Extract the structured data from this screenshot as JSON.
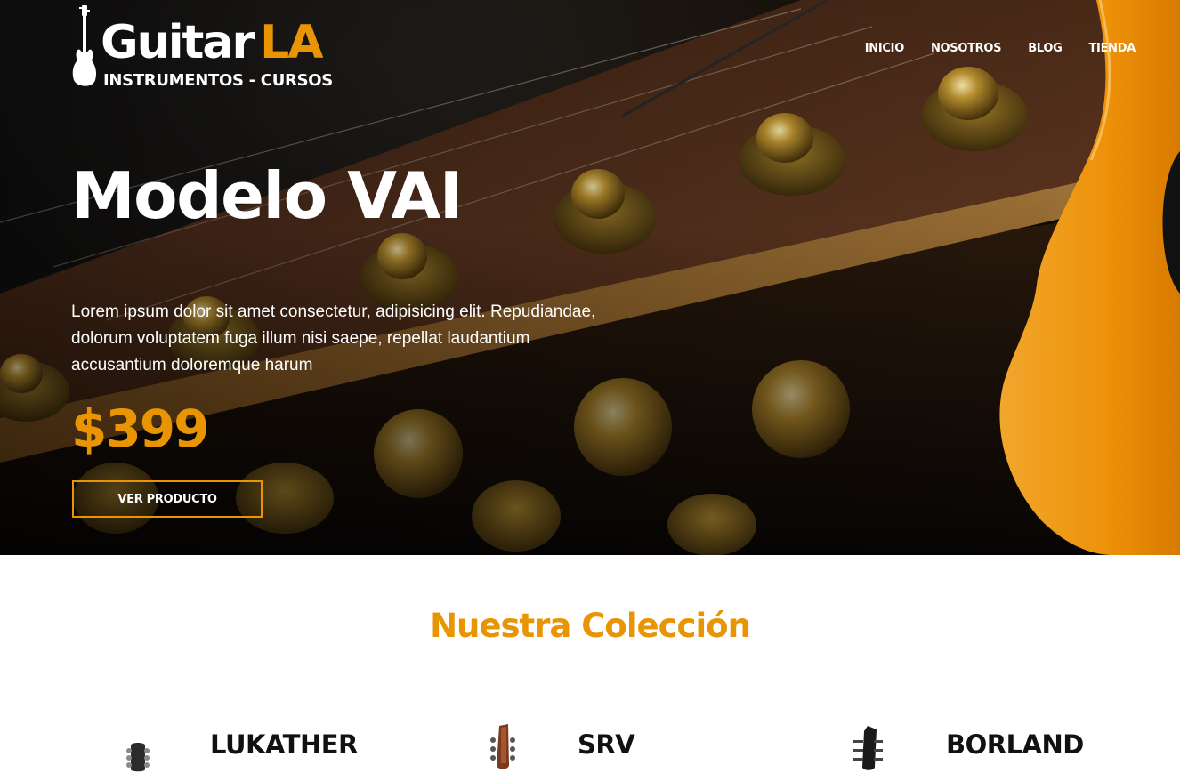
{
  "brand": {
    "name_primary": "Guitar",
    "name_accent": "LA",
    "tagline": "INSTRUMENTOS - CURSOS",
    "accent_color": "#e99402",
    "logo_icon": "electric-guitar-icon"
  },
  "nav": {
    "items": [
      {
        "label": "INICIO"
      },
      {
        "label": "NOSOTROS"
      },
      {
        "label": "BLOG"
      },
      {
        "label": "TIENDA"
      }
    ]
  },
  "hero": {
    "title": "Modelo VAI",
    "description": "Lorem ipsum dolor sit amet consectetur, adipisicing elit. Repudiandae, dolorum voluptatem fuga illum nisi saepe, repellat laudantium accusantium doloremque harum",
    "price": "$399",
    "cta_label": "VER PRODUCTO"
  },
  "collection": {
    "title": "Nuestra Colección",
    "products": [
      {
        "name": "LUKATHER",
        "icon": "guitar-headstock-icon"
      },
      {
        "name": "SRV",
        "icon": "guitar-headstock-icon"
      },
      {
        "name": "BORLAND",
        "icon": "guitar-headstock-icon"
      }
    ]
  }
}
